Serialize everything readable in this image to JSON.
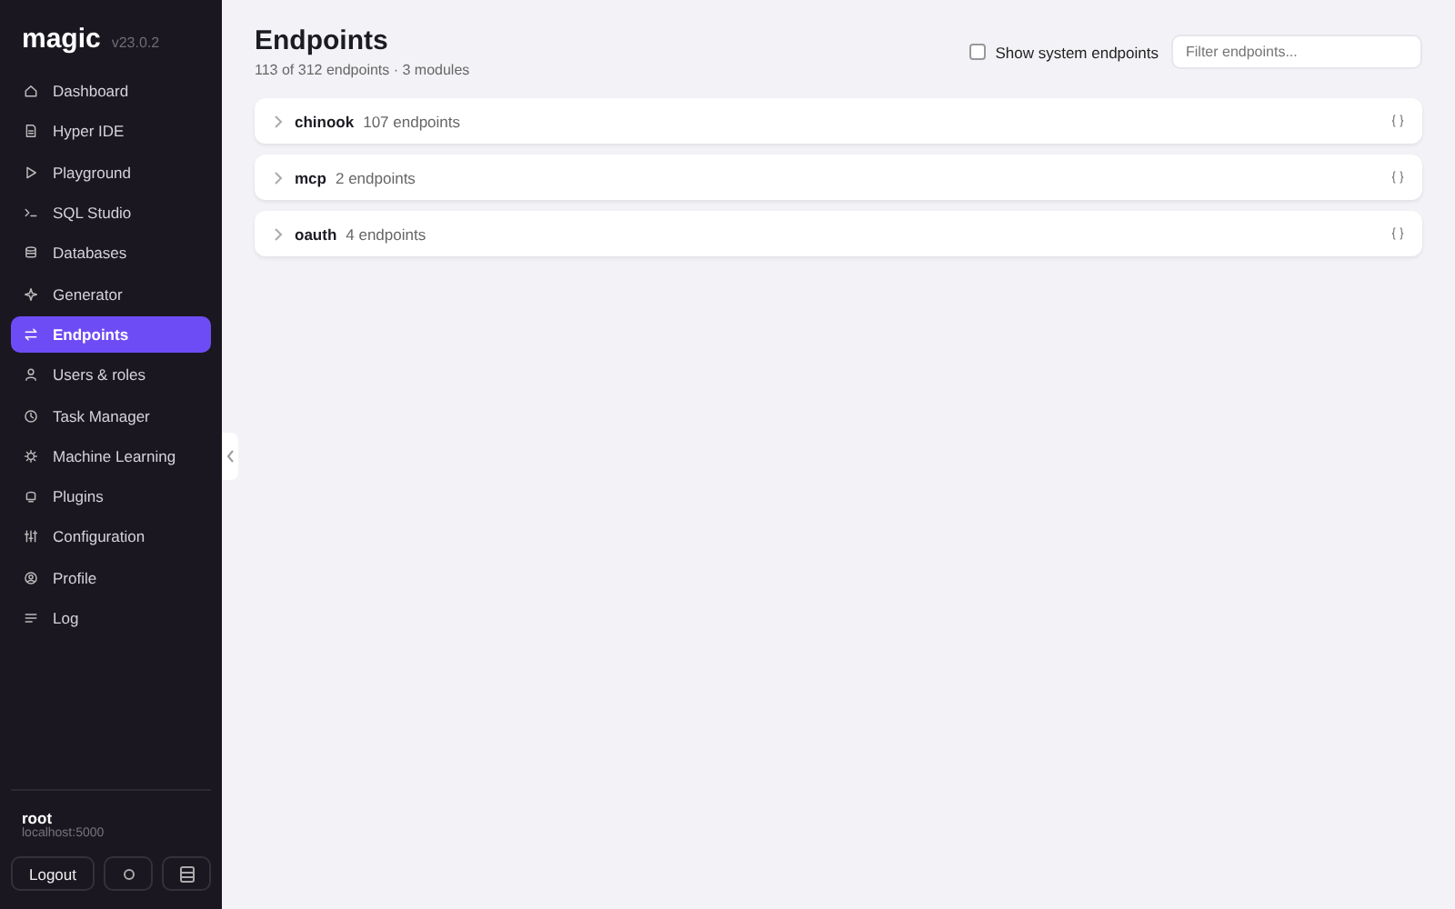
{
  "sidebar": {
    "brand": "magic",
    "version": "v23.0.2",
    "items": [
      {
        "label": "Dashboard",
        "selected": false
      },
      {
        "label": "Hyper IDE",
        "selected": false
      },
      {
        "label": "Playground",
        "selected": false
      },
      {
        "label": "SQL Studio",
        "selected": false
      },
      {
        "label": "Databases",
        "selected": false
      },
      {
        "label": "Generator",
        "selected": false
      },
      {
        "label": "Endpoints",
        "selected": true
      },
      {
        "label": "Users & roles",
        "selected": false
      },
      {
        "label": "Task Manager",
        "selected": false
      },
      {
        "label": "Machine Learning",
        "selected": false
      },
      {
        "label": "Plugins",
        "selected": false
      },
      {
        "label": "Configuration",
        "selected": false
      },
      {
        "label": "Profile",
        "selected": false
      },
      {
        "label": "Log",
        "selected": false
      }
    ],
    "user": {
      "name": "root",
      "host": "localhost:5000"
    },
    "logout": "Logout"
  },
  "header": {
    "title": "Endpoints",
    "subtitle": "113 of 312 endpoints · 3 modules",
    "show_system": {
      "label": "Show system endpoints",
      "checked": false
    },
    "filter": {
      "placeholder": "Filter endpoints..."
    }
  },
  "modules": [
    {
      "name": "chinook",
      "count": "107 endpoints",
      "expanded": false
    },
    {
      "name": "mcp",
      "count": "2 endpoints",
      "expanded": false
    },
    {
      "name": "oauth",
      "count": "4 endpoints",
      "expanded": false
    }
  ]
}
